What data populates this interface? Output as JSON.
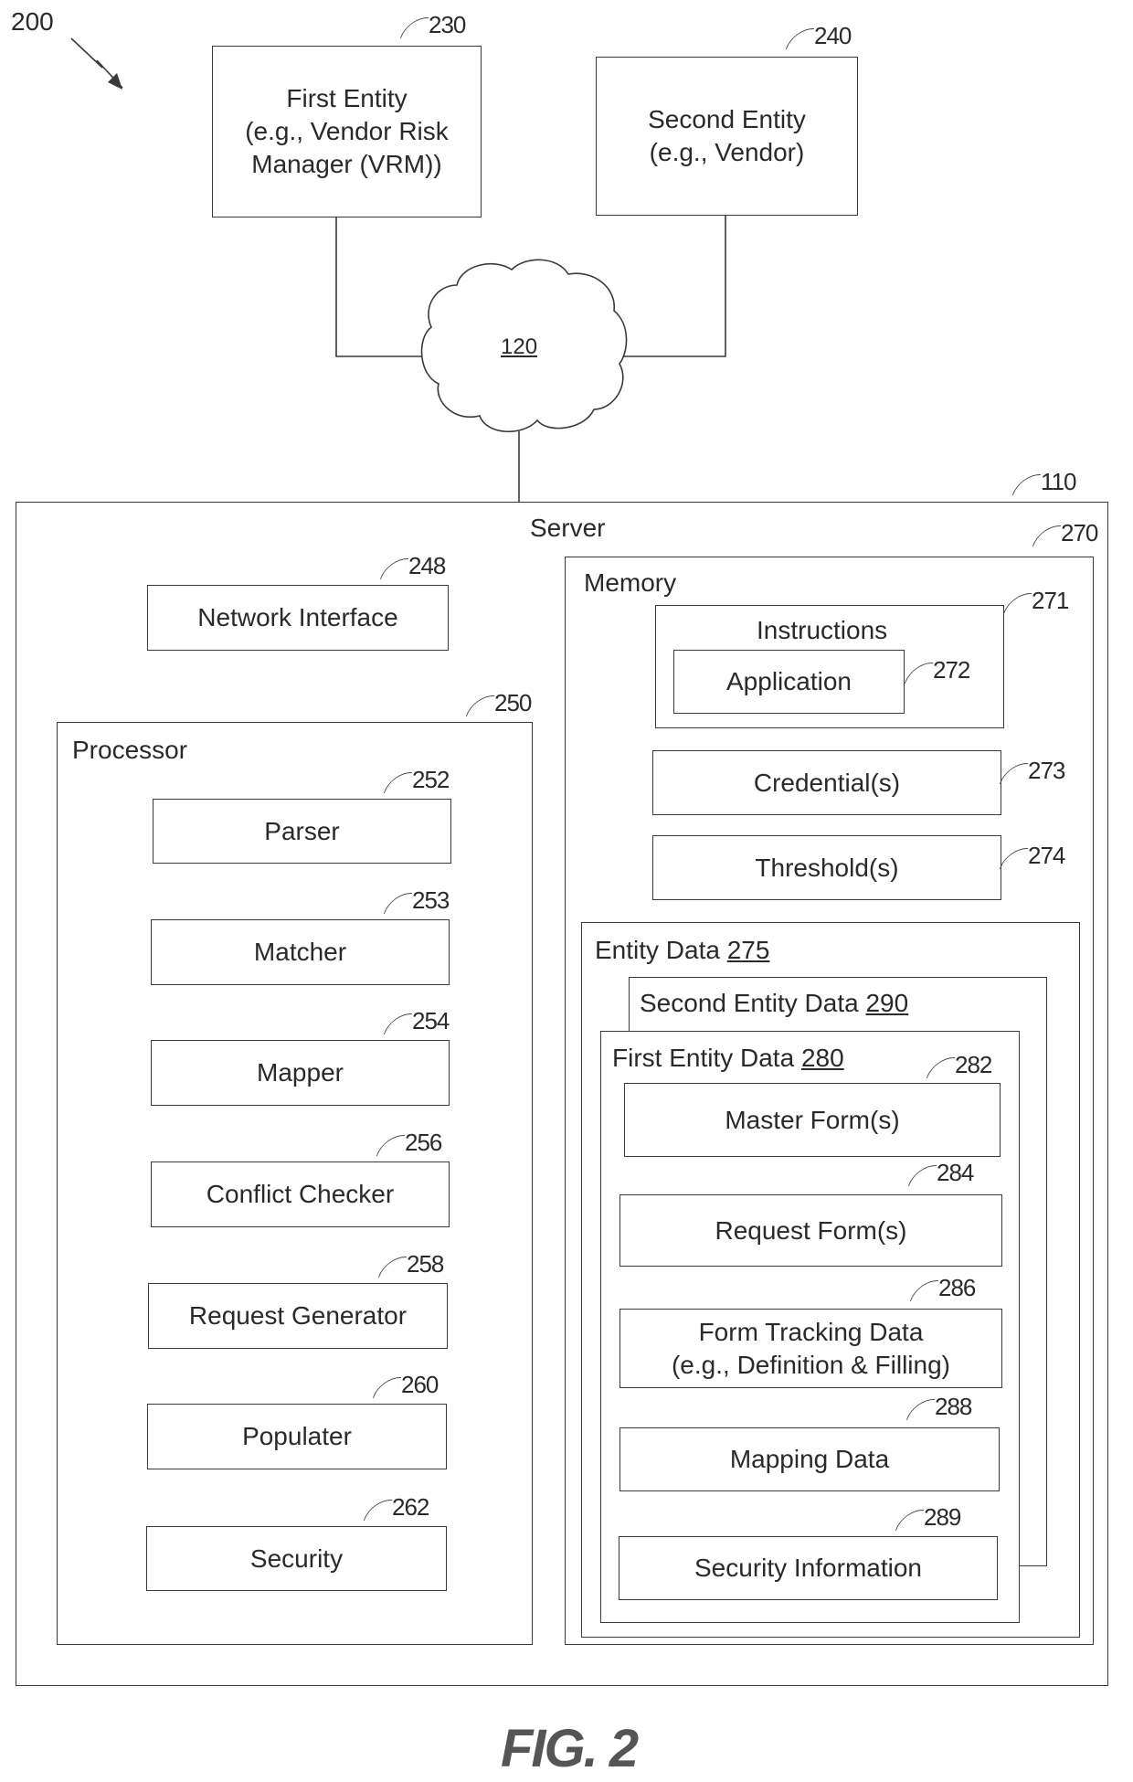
{
  "figure": {
    "number_label": "200",
    "caption": "FIG. 2"
  },
  "entities": {
    "first": {
      "ref": "230",
      "lines": [
        "First Entity",
        "(e.g., Vendor Risk",
        "Manager (VRM))"
      ]
    },
    "second": {
      "ref": "240",
      "lines": [
        "Second Entity",
        "(e.g., Vendor)"
      ]
    }
  },
  "network": {
    "ref": "120"
  },
  "server": {
    "ref": "110",
    "title": "Server",
    "network_interface": {
      "ref": "248",
      "label": "Network Interface"
    },
    "processor": {
      "ref": "250",
      "title": "Processor",
      "modules": [
        {
          "ref": "252",
          "label": "Parser"
        },
        {
          "ref": "253",
          "label": "Matcher"
        },
        {
          "ref": "254",
          "label": "Mapper"
        },
        {
          "ref": "256",
          "label": "Conflict Checker"
        },
        {
          "ref": "258",
          "label": "Request Generator"
        },
        {
          "ref": "260",
          "label": "Populater"
        },
        {
          "ref": "262",
          "label": "Security"
        }
      ]
    },
    "memory": {
      "ref": "270",
      "title": "Memory",
      "instructions": {
        "ref": "271",
        "title": "Instructions",
        "application": {
          "ref": "272",
          "label": "Application"
        }
      },
      "credentials": {
        "ref": "273",
        "label": "Credential(s)"
      },
      "thresholds": {
        "ref": "274",
        "label": "Threshold(s)"
      },
      "entity_data": {
        "title": "Entity Data",
        "ref": "275",
        "second_entity_data": {
          "title": "Second Entity Data",
          "ref": "290"
        },
        "first_entity_data": {
          "title": "First Entity Data",
          "ref": "280",
          "items": [
            {
              "ref": "282",
              "lines": [
                "Master Form(s)"
              ]
            },
            {
              "ref": "284",
              "lines": [
                "Request Form(s)"
              ]
            },
            {
              "ref": "286",
              "lines": [
                "Form Tracking Data",
                "(e.g., Definition & Filling)"
              ]
            },
            {
              "ref": "288",
              "lines": [
                "Mapping Data"
              ]
            },
            {
              "ref": "289",
              "lines": [
                "Security Information"
              ]
            }
          ]
        }
      }
    }
  }
}
